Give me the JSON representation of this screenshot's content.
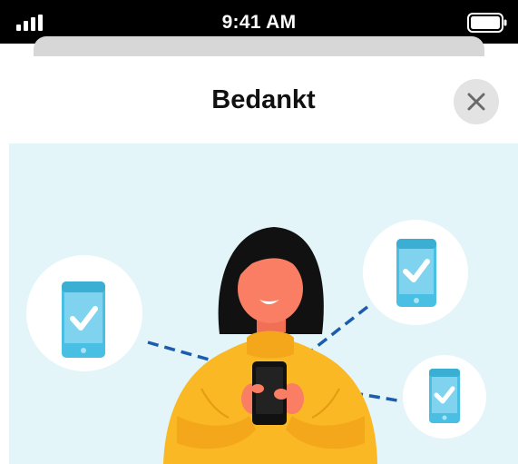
{
  "status_bar": {
    "time": "9:41 AM",
    "signal_icon": "signal-bars-icon",
    "battery_icon": "battery-icon"
  },
  "sheet": {
    "title": "Bedankt",
    "close_icon": "close-icon"
  },
  "illustration": {
    "description_icons": [
      "phone-check-icon",
      "phone-check-icon",
      "phone-check-icon"
    ]
  },
  "colors": {
    "status_bar_bg": "#000000",
    "sheet_bg": "#ffffff",
    "illustration_bg": "#e3f5f9",
    "phone_blue": "#49bfe3",
    "sweater_yellow": "#f9b824",
    "skin": "#fa7e63",
    "hair": "#111111",
    "dash_blue": "#1c5cae"
  }
}
